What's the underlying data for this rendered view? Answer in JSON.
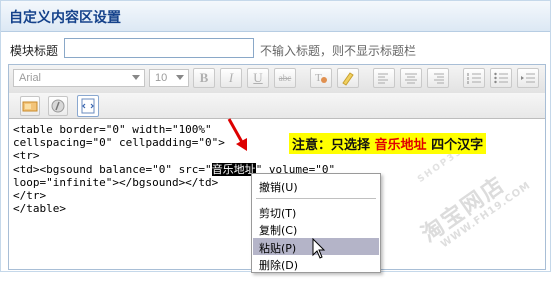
{
  "header": {
    "title": "自定义内容区设置"
  },
  "module_title": {
    "label": "模块标题",
    "value": "",
    "hint": "不输入标题，则不显示标题栏"
  },
  "toolbar": {
    "font_family": "Arial",
    "font_size": "10",
    "buttons": [
      {
        "name": "bold-button",
        "label": "B"
      },
      {
        "name": "italic-button",
        "label": "I"
      },
      {
        "name": "underline-button",
        "label": "U"
      },
      {
        "name": "strikethrough-button",
        "label": "abc"
      }
    ]
  },
  "code_lines": [
    "<table border=\"0\" width=\"100%\"",
    "cellspacing=\"0\" cellpadding=\"0\">",
    "<tr>",
    "<td><bgsound balance=\"0\" src=\"",
    "音乐地址",
    "\" volume=\"0\"",
    "loop=\"infinite\"></bgsound></td>",
    "</tr>",
    "</table>"
  ],
  "note": {
    "prefix": "注意：只选择 ",
    "highlight": "音乐地址",
    "suffix": " 四个汉字"
  },
  "context_menu": [
    {
      "label": "撤销(U)",
      "selected": false
    },
    {
      "label": "剪切(T)",
      "selected": false
    },
    {
      "label": "复制(C)",
      "selected": false
    },
    {
      "label": "粘贴(P)",
      "selected": true
    },
    {
      "label": "删除(D)",
      "selected": false
    }
  ],
  "watermark": {
    "line1": "淘宝网店",
    "line2": "WWW.FH19.COM",
    "line3": "SHOP35868"
  },
  "colors": {
    "title": "#15428b",
    "note_bg": "#ffff00",
    "note_red": "#e00000",
    "arrow": "#dd0000",
    "menu_selected": "#b4b4c8"
  }
}
